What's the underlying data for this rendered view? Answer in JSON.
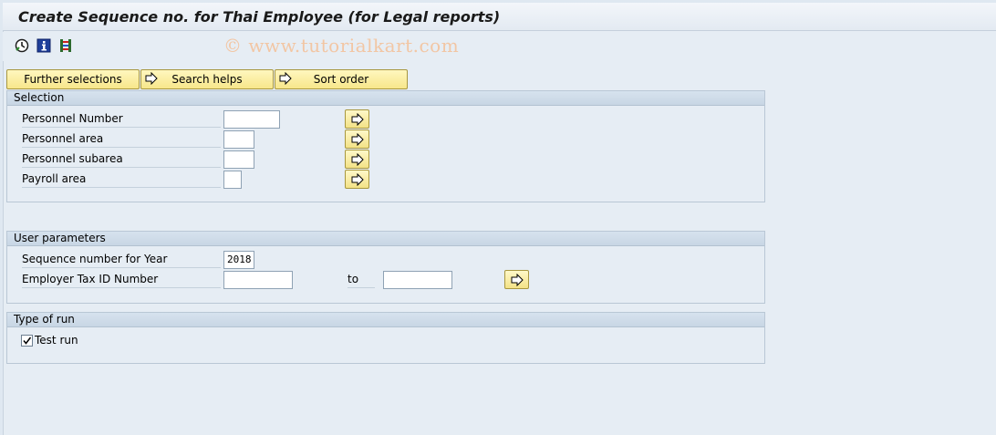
{
  "window": {
    "title": "Create Sequence no. for Thai Employee (for Legal reports)"
  },
  "toolbar": {
    "icons": [
      "execute-clock-icon",
      "info-icon",
      "selection-options-icon"
    ],
    "watermark": "© www.tutorialkart.com"
  },
  "buttons": {
    "further_selections": "Further selections",
    "search_helps": "Search helps",
    "sort_order": "Sort order"
  },
  "selection": {
    "title": "Selection",
    "rows": [
      {
        "label": "Personnel Number",
        "value": ""
      },
      {
        "label": "Personnel area",
        "value": ""
      },
      {
        "label": "Personnel subarea",
        "value": ""
      },
      {
        "label": "Payroll area",
        "value": ""
      }
    ]
  },
  "user_parameters": {
    "title": "User parameters",
    "sequence_label": "Sequence number  for Year",
    "sequence_value": "2018",
    "employer_label": "Employer Tax ID Number",
    "employer_from": "",
    "to_label": "to",
    "employer_to": ""
  },
  "type_of_run": {
    "title": "Type of run",
    "test_run_label": "Test run",
    "test_run_checked": true
  },
  "colors": {
    "background": "#e6edf4",
    "button_yellow": "#f7e68a",
    "group_header": "#c8d6e4"
  }
}
